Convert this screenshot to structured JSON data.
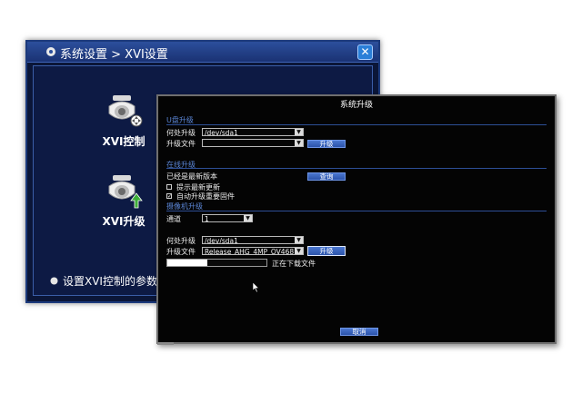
{
  "background_window": {
    "title": "系统设置 > XVI设置",
    "close_glyph": "✕",
    "tiles": [
      {
        "label": "XVI控制",
        "icon": "camera-dome-ptz-icon"
      },
      {
        "label": "XVI升级",
        "icon": "camera-dome-upgrade-icon"
      }
    ],
    "description": "设置XVI控制的参数"
  },
  "dialog": {
    "title": "系统升级",
    "usb_section": {
      "heading": "U盘升级",
      "location_label": "何处升级",
      "location_value": "/dev/sda1",
      "file_label": "升级文件",
      "file_value": "",
      "upgrade_button": "升级"
    },
    "online_section": {
      "heading": "在线升级",
      "status": "已经是最新版本",
      "query_button": "查询",
      "notify_label": "提示最新更新",
      "notify_checked": false,
      "auto_label": "自动升级重要固件",
      "auto_checked": true
    },
    "camera_section": {
      "heading": "摄像机升级",
      "channel_label": "通道",
      "channel_value": "1",
      "location_label": "何处升级",
      "location_value": "/dev/sda1",
      "file_label": "升级文件",
      "file_value": "Release_AHG_4MP_OV468",
      "upgrade_button": "升级",
      "progress": 0.4,
      "progress_status": "正在下载文件"
    },
    "cancel_button": "取消"
  },
  "colors": {
    "dialog_bg": "#040404",
    "section_heading": "#5b86d6",
    "button_blue": "#3a64bd",
    "back_window_bg": "#0b1638"
  }
}
